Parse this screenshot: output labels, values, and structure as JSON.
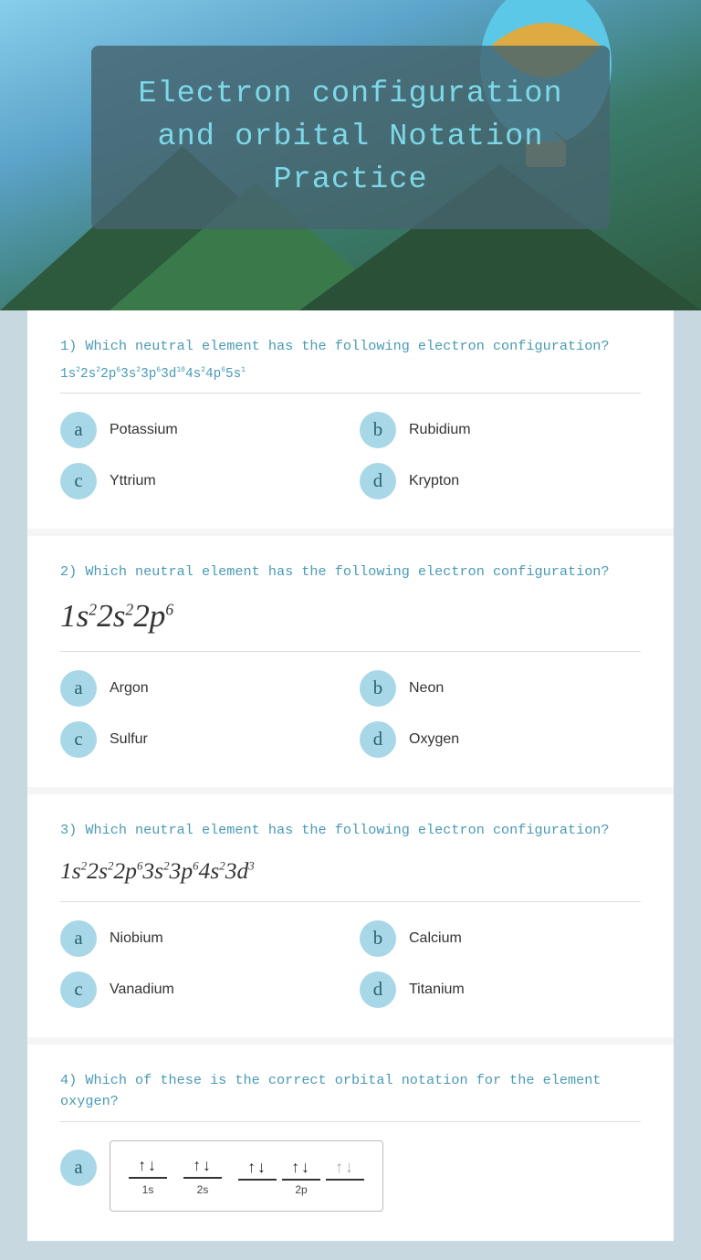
{
  "hero": {
    "title": "Electron configuration and orbital Notation Practice"
  },
  "questions": [
    {
      "id": "q1",
      "number": "1)",
      "text": "Which neutral element has the following electron configuration?",
      "config": "1s²2s²2p⁶3s²3p⁶3d¹⁰4s²4p⁶5s¹",
      "config_display": "small",
      "options": [
        {
          "badge": "a",
          "text": "Potassium"
        },
        {
          "badge": "b",
          "text": "Rubidium"
        },
        {
          "badge": "c",
          "text": "Yttrium"
        },
        {
          "badge": "d",
          "text": "Krypton"
        }
      ]
    },
    {
      "id": "q2",
      "number": "2)",
      "text": "Which neutral element has the following electron configuration?",
      "config": "1s²2s²2p⁶",
      "config_display": "large",
      "options": [
        {
          "badge": "a",
          "text": "Argon"
        },
        {
          "badge": "b",
          "text": "Neon"
        },
        {
          "badge": "c",
          "text": "Sulfur"
        },
        {
          "badge": "d",
          "text": "Oxygen"
        }
      ]
    },
    {
      "id": "q3",
      "number": "3)",
      "text": "Which neutral element has the following electron configuration?",
      "config": "1s²2s²2p⁶3s²3p⁶4s²3d³",
      "config_display": "medium",
      "options": [
        {
          "badge": "a",
          "text": "Niobium"
        },
        {
          "badge": "b",
          "text": "Calcium"
        },
        {
          "badge": "c",
          "text": "Vanadium"
        },
        {
          "badge": "d",
          "text": "Titanium"
        }
      ]
    },
    {
      "id": "q4",
      "number": "4)",
      "text": "Which of these is the correct orbital notation for the element oxygen?",
      "config_display": "orbital",
      "options": [
        {
          "badge": "a",
          "diagram": true
        }
      ]
    }
  ],
  "labels": {
    "a": "a",
    "b": "b",
    "c": "c",
    "d": "d"
  }
}
